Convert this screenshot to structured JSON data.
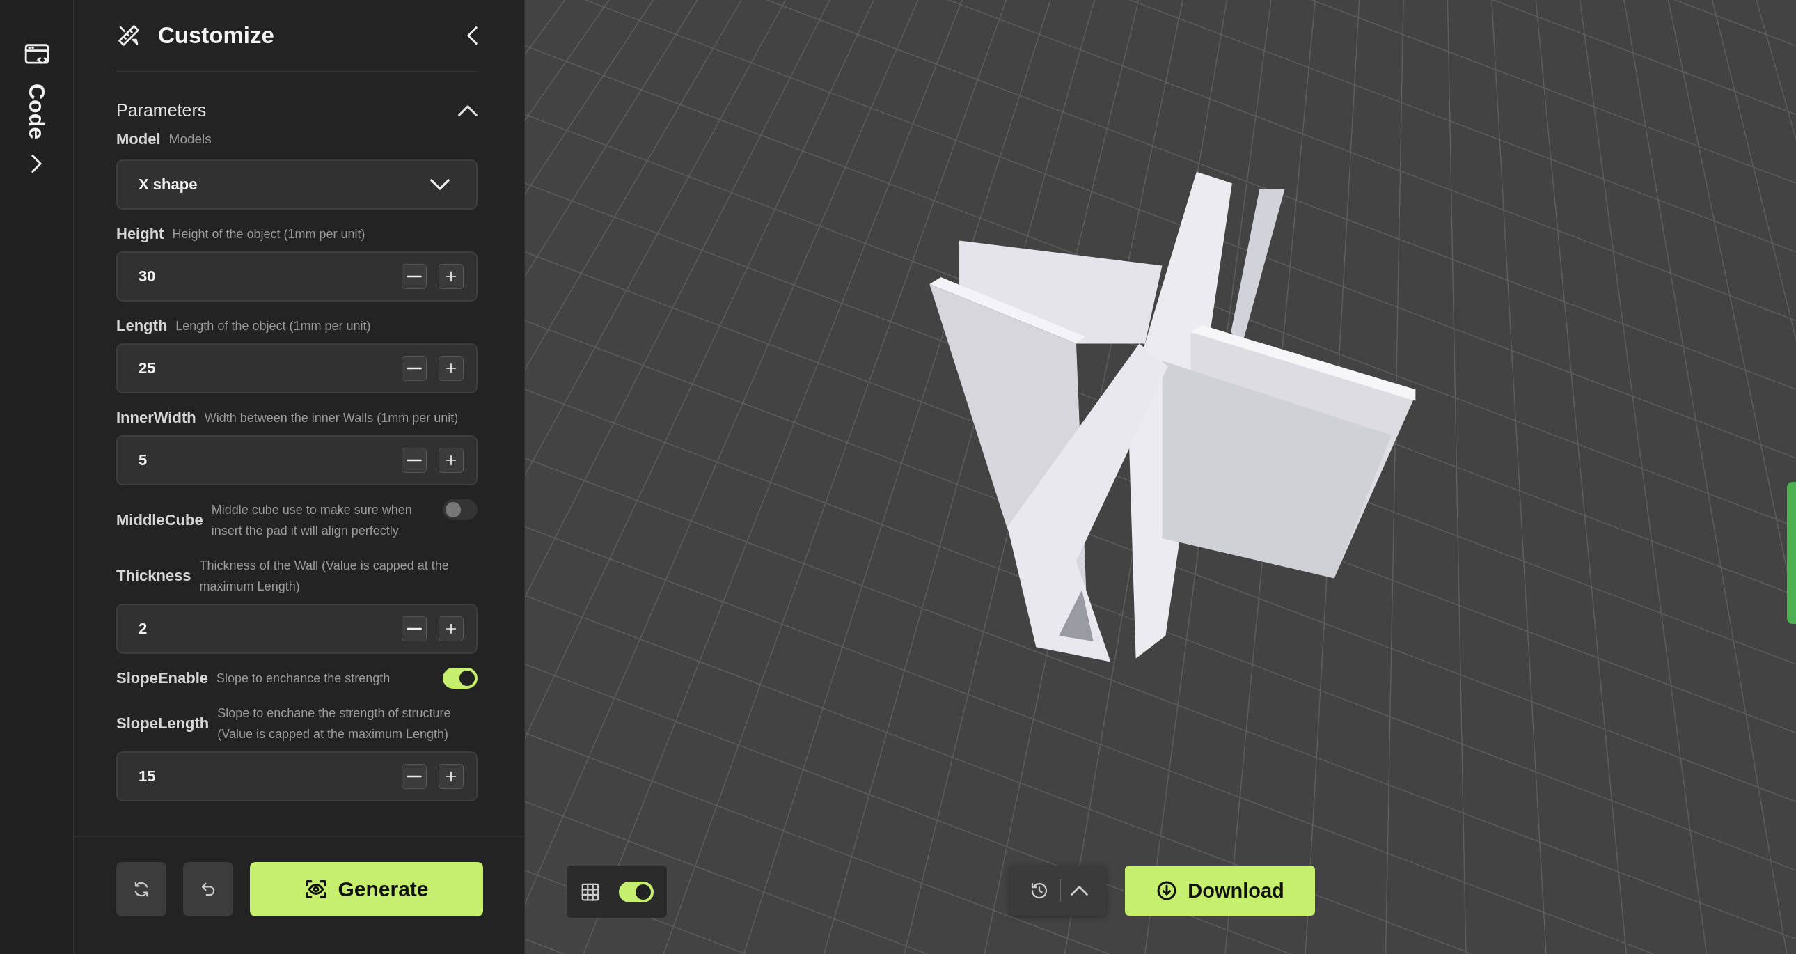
{
  "sidebar": {
    "label": "Code"
  },
  "panel": {
    "title": "Customize",
    "section": {
      "title": "Parameters",
      "expanded": true
    },
    "params": [
      {
        "kind": "select",
        "label": "Model",
        "hint": "Models",
        "value": "X shape"
      },
      {
        "kind": "number",
        "label": "Height",
        "hint": "Height of the object (1mm per unit)",
        "value": "30"
      },
      {
        "kind": "number",
        "label": "Length",
        "hint": "Length of the object (1mm per unit)",
        "value": "25"
      },
      {
        "kind": "number",
        "label": "InnerWidth",
        "hint": "Width between the inner Walls (1mm per unit)",
        "value": "5"
      },
      {
        "kind": "toggle",
        "label": "MiddleCube",
        "hint": "Middle cube use to make sure when insert the pad it will align perfectly",
        "on": false
      },
      {
        "kind": "number",
        "label": "Thickness",
        "hint": "Thickness of the Wall (Value is capped at the maximum Length)",
        "value": "2"
      },
      {
        "kind": "toggle",
        "label": "SlopeEnable",
        "hint": "Slope to enchance the strength",
        "on": true
      },
      {
        "kind": "number",
        "label": "SlopeLength",
        "hint": "Slope to enchane the strength of structure (Value is capped at the maximum Length)",
        "value": "15"
      }
    ],
    "footer": {
      "generate_label": "Generate"
    }
  },
  "viewport": {
    "kind": "picture",
    "grid_toggle": {
      "on": true
    },
    "download_label": "Download"
  }
}
